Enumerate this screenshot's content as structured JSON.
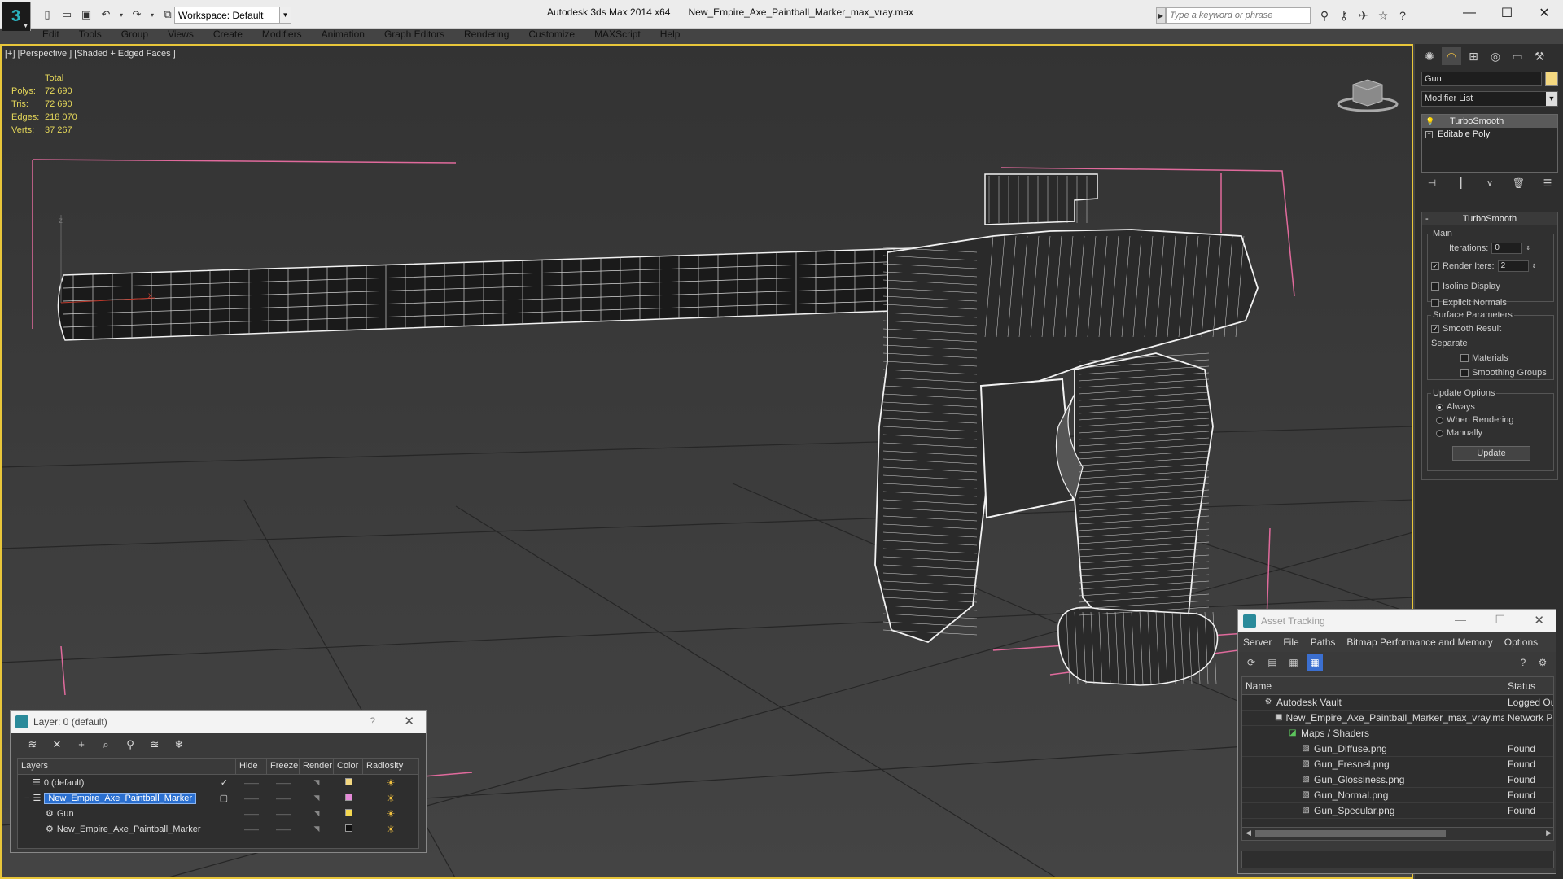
{
  "app": {
    "title": "Autodesk 3ds Max  2014 x64",
    "file": "New_Empire_Axe_Paintball_Marker_max_vray.max",
    "workspace": "Workspace: Default",
    "search_placeholder": "Type a keyword or phrase",
    "logo": "3"
  },
  "menu": [
    "Edit",
    "Tools",
    "Group",
    "Views",
    "Create",
    "Modifiers",
    "Animation",
    "Graph Editors",
    "Rendering",
    "Customize",
    "MAXScript",
    "Help"
  ],
  "viewport": {
    "label": "[+] [Perspective ] [Shaded + Edged Faces ]",
    "stats": {
      "header": "Total",
      "rows": [
        {
          "k": "Polys:",
          "v": "72 690"
        },
        {
          "k": "Tris:",
          "v": "72 690"
        },
        {
          "k": "Edges:",
          "v": "218 070"
        },
        {
          "k": "Verts:",
          "v": "37 267"
        }
      ]
    }
  },
  "command_panel": {
    "object_name": "Gun",
    "object_color": "#f4d880",
    "modifier_list": "Modifier List",
    "stack": [
      "TurboSmooth",
      "Editable Poly"
    ],
    "rollout_title": "TurboSmooth",
    "main_group": "Main",
    "iterations_label": "Iterations:",
    "iterations_value": "0",
    "render_iters_label": "Render Iters:",
    "render_iters_value": "2",
    "isoline": "Isoline Display",
    "explicit_normals": "Explicit Normals",
    "surface_group": "Surface Parameters",
    "smooth_result": "Smooth Result",
    "separate": "Separate",
    "materials": "Materials",
    "smoothing_groups": "Smoothing Groups",
    "update_group": "Update Options",
    "always": "Always",
    "when_rendering": "When Rendering",
    "manually": "Manually",
    "update_button": "Update"
  },
  "layer_dialog": {
    "title": "Layer: 0 (default)",
    "help": "?",
    "columns": [
      "Layers",
      "Hide",
      "Freeze",
      "Render",
      "Color",
      "Radiosity"
    ],
    "rows": [
      {
        "name": "0 (default)",
        "color": "#f4d880"
      },
      {
        "name": "New_Empire_Axe_Paintball_Marker",
        "color": "#e58ad8"
      },
      {
        "name": "Gun",
        "color": "#f4d850"
      },
      {
        "name": "New_Empire_Axe_Paintball_Marker",
        "color": "#111111"
      }
    ]
  },
  "asset_dialog": {
    "title": "Asset Tracking",
    "menu": [
      "Server",
      "File",
      "Paths",
      "Bitmap Performance and Memory",
      "Options"
    ],
    "col_name": "Name",
    "col_status": "Status",
    "rows": [
      {
        "name": "Autodesk Vault",
        "status": "Logged Ou"
      },
      {
        "name": "New_Empire_Axe_Paintball_Marker_max_vray.max",
        "status": "Network P"
      },
      {
        "name": "Maps / Shaders",
        "status": ""
      },
      {
        "name": "Gun_Diffuse.png",
        "status": "Found"
      },
      {
        "name": "Gun_Fresnel.png",
        "status": "Found"
      },
      {
        "name": "Gun_Glossiness.png",
        "status": "Found"
      },
      {
        "name": "Gun_Normal.png",
        "status": "Found"
      },
      {
        "name": "Gun_Specular.png",
        "status": "Found"
      }
    ]
  },
  "colors": {
    "accent": "#3b6fd0",
    "viewport_border": "#e8c63a",
    "stats_text": "#e6d85a"
  }
}
